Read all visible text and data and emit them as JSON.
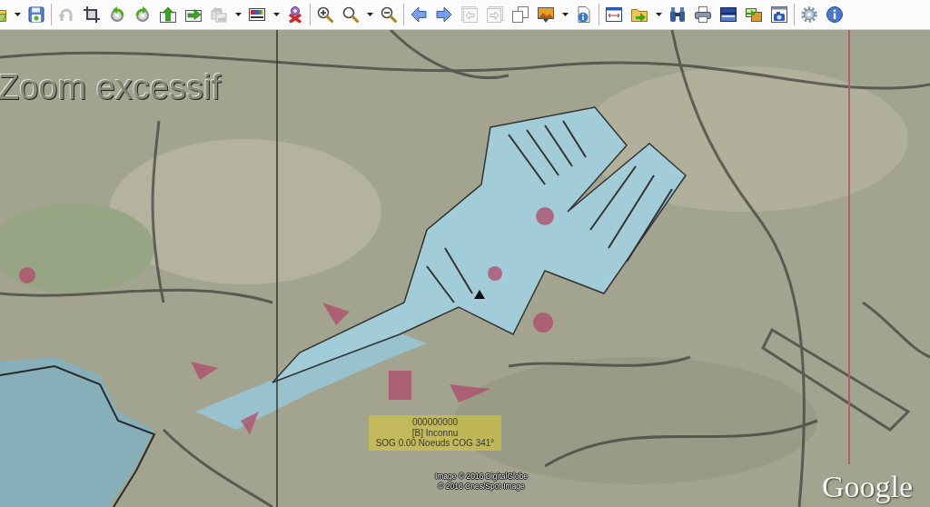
{
  "toolbar": {
    "groups": [
      {
        "items": [
          {
            "disabled": false,
            "dropdown": true
          },
          {
            "disabled": false,
            "dropdown": false
          }
        ]
      },
      {
        "items": [
          {
            "disabled": true,
            "dropdown": false
          },
          {
            "disabled": false,
            "dropdown": false
          },
          {
            "disabled": false,
            "dropdown": false
          },
          {
            "disabled": false,
            "dropdown": false
          },
          {
            "disabled": false,
            "dropdown": false
          },
          {
            "disabled": false,
            "dropdown": false
          },
          {
            "disabled": true,
            "dropdown": true
          },
          {
            "disabled": false,
            "dropdown": true
          },
          {
            "disabled": false,
            "dropdown": false
          }
        ]
      },
      {
        "items": [
          {
            "disabled": false,
            "dropdown": false
          },
          {
            "disabled": false,
            "dropdown": true
          },
          {
            "disabled": false,
            "dropdown": false
          }
        ]
      },
      {
        "items": [
          {
            "disabled": false,
            "dropdown": false
          },
          {
            "disabled": false,
            "dropdown": false
          },
          {
            "disabled": true,
            "dropdown": false
          },
          {
            "disabled": true,
            "dropdown": false
          },
          {
            "disabled": false,
            "dropdown": false
          },
          {
            "disabled": false,
            "dropdown": true
          },
          {
            "disabled": false,
            "dropdown": false
          }
        ]
      },
      {
        "items": [
          {
            "disabled": false,
            "dropdown": false
          },
          {
            "disabled": false,
            "dropdown": true
          },
          {
            "disabled": false,
            "dropdown": false
          },
          {
            "disabled": false,
            "dropdown": false
          },
          {
            "disabled": false,
            "dropdown": false
          },
          {
            "disabled": false,
            "dropdown": false
          },
          {
            "disabled": false,
            "dropdown": false
          }
        ]
      },
      {
        "items": [
          {
            "disabled": false,
            "dropdown": false
          },
          {
            "disabled": false,
            "dropdown": false
          }
        ]
      }
    ]
  },
  "map": {
    "notice": "Zoom excessif",
    "vessel_label": {
      "id": "000000000",
      "name": "[B] Inconnu",
      "motion": "SOG 0.00 Noeuds COG 341°"
    },
    "credits": [
      "Image © 2016 DigitalGlobe",
      "© 2016 Cnes/Spot Image"
    ],
    "logo": "Google"
  }
}
